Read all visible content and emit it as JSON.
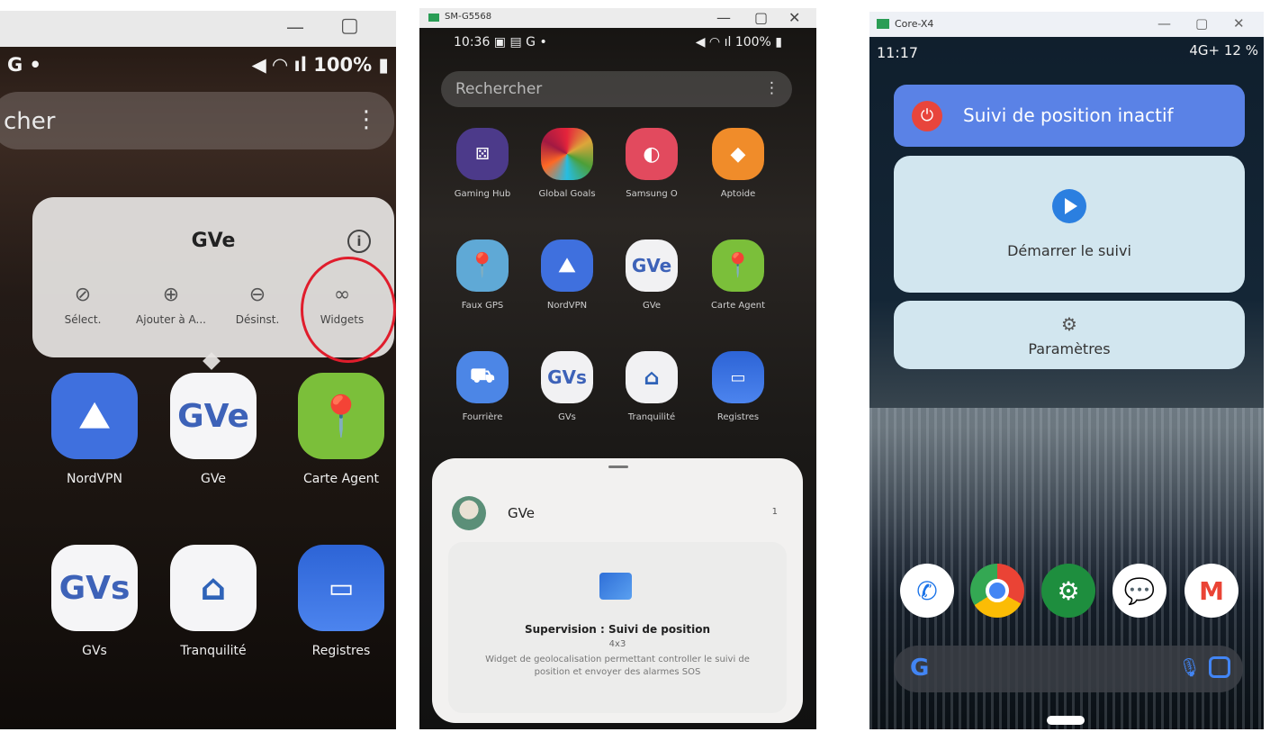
{
  "panel1": {
    "status_left": "G •",
    "status_right": "100%",
    "search_text": "cher",
    "menu_title": "GVe",
    "actions": [
      "Sélect.",
      "Ajouter à A...",
      "Désinst.",
      "Widgets"
    ],
    "apps_row1": [
      "NordVPN",
      "GVe",
      "Carte Agent"
    ],
    "apps_row2": [
      "GVs",
      "Tranquilité",
      "Registres"
    ],
    "icon_text_gve": "GVe",
    "icon_text_gvs": "GVs"
  },
  "panel2": {
    "window_title": "SM-G5568",
    "status_time": "10:36",
    "status_right": "100%",
    "search_placeholder": "Rechercher",
    "row1": [
      "Gaming Hub",
      "Global Goals",
      "Samsung O",
      "Aptoide"
    ],
    "row2": [
      "Faux GPS",
      "NordVPN",
      "GVe",
      "Carte Agent"
    ],
    "row3": [
      "Fourrière",
      "GVs",
      "Tranquilité",
      "Registres"
    ],
    "sheet_app_name": "GVe",
    "sheet_count": "1",
    "widget_title": "Supervision : Suivi de position",
    "widget_size": "4x3",
    "widget_desc": "Widget de geolocalisation permettant controller le suivi de position et envoyer des alarmes SOS"
  },
  "panel3": {
    "window_title": "Core-X4",
    "status_time": "11:17",
    "status_right": "4G+  12 %",
    "btn_status": "Suivi de position inactif",
    "btn_start": "Démarrer le suivi",
    "btn_settings": "Paramètres",
    "google_letter": "G"
  },
  "colors": {
    "red_circle": "#e01d2c",
    "inactive_blue": "#5a82e6",
    "card_light_blue": "#d2e6ef",
    "play_blue": "#2b7fe0"
  }
}
